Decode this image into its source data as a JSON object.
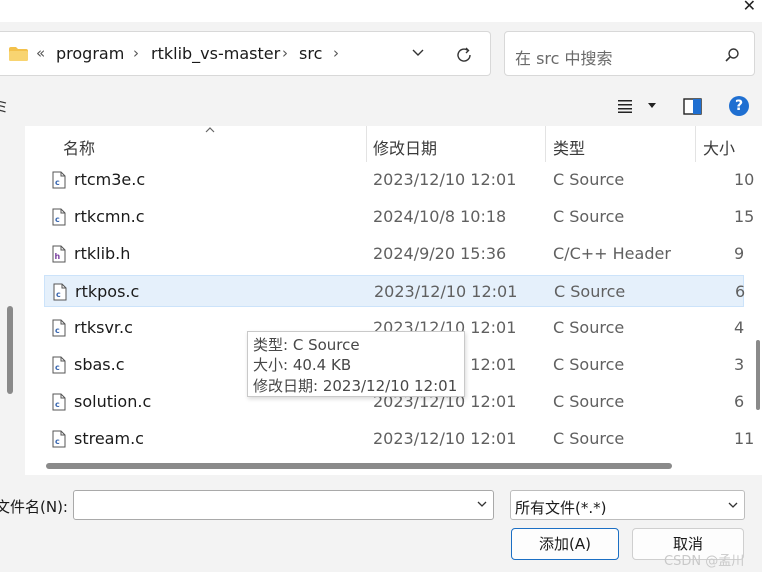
{
  "window": {
    "close_glyph": "✕"
  },
  "address_bar": {
    "back_glyph": "«",
    "breadcrumbs": [
      "program",
      "rtklib_vs-master",
      "src"
    ],
    "separator": "›",
    "folder_icon": "folder-icon",
    "dropdown_icon": "chevron-down-icon",
    "refresh_icon": "refresh-icon"
  },
  "search": {
    "placeholder": "在 src 中搜索",
    "icon": "search-icon"
  },
  "toolbar": {
    "left_cut_text": "ミ",
    "view_icon": "view-list-icon",
    "pane_icon": "preview-pane-icon",
    "help_label": "?"
  },
  "columns": {
    "name": "名称",
    "date": "修改日期",
    "type": "类型",
    "size": "大小"
  },
  "files": [
    {
      "name": "rtcm3e.c",
      "date": "2023/12/10 12:01",
      "type": "C Source",
      "size": "10",
      "icon": "c-file-icon",
      "selected": false
    },
    {
      "name": "rtkcmn.c",
      "date": "2024/10/8 10:18",
      "type": "C Source",
      "size": "15",
      "icon": "c-file-icon",
      "selected": false
    },
    {
      "name": "rtklib.h",
      "date": "2024/9/20 15:36",
      "type": "C/C++ Header",
      "size": "9",
      "icon": "header-file-icon",
      "selected": false
    },
    {
      "name": "rtkpos.c",
      "date": "2023/12/10 12:01",
      "type": "C Source",
      "size": "6",
      "icon": "c-file-icon",
      "selected": true
    },
    {
      "name": "rtksvr.c",
      "date": "2023/12/10 12:01",
      "type": "C Source",
      "size": "4",
      "icon": "c-file-icon",
      "selected": false
    },
    {
      "name": "sbas.c",
      "date": "2023/12/10 12:01",
      "type": "C Source",
      "size": "3",
      "icon": "c-file-icon",
      "selected": false
    },
    {
      "name": "solution.c",
      "date": "2023/12/10 12:01",
      "type": "C Source",
      "size": "6",
      "icon": "c-file-icon",
      "selected": false
    },
    {
      "name": "stream.c",
      "date": "2023/12/10 12:01",
      "type": "C Source",
      "size": "11",
      "icon": "c-file-icon",
      "selected": false
    }
  ],
  "tooltip": {
    "type_line": "类型: C Source",
    "size_line": "大小: 40.4 KB",
    "date_line": "修改日期: 2023/12/10 12:01"
  },
  "bottom": {
    "filename_label": "文件名(N):",
    "filename_value": "",
    "filter_value": "所有文件(*.*)",
    "add_button": "添加(A)",
    "cancel_button": "取消"
  },
  "watermark": "CSDN @孟川",
  "colors": {
    "selection": "#e5f0fb",
    "accent": "#1b6fc4",
    "help": "#1f6fd1"
  }
}
